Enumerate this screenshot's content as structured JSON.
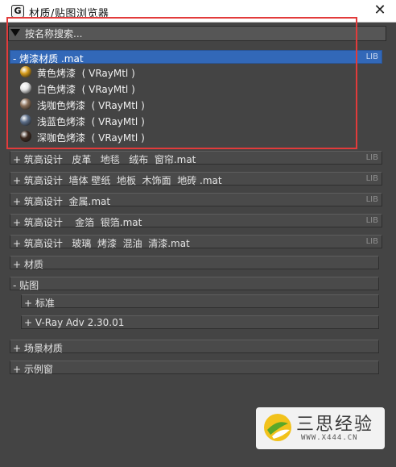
{
  "window": {
    "app_icon_glyph": "G",
    "title": "材质/贴图浏览器",
    "close_glyph": "✕"
  },
  "search": {
    "placeholder": "按名称搜索..."
  },
  "categories": {
    "lacquer": {
      "label": "- 烤漆材质 .mat",
      "lib": "LIB"
    },
    "leather": {
      "label": "+ 筑高设计   皮革   地毯   绒布  窗帘.mat",
      "lib": "LIB"
    },
    "wall": {
      "label": "+ 筑高设计  墙体 壁纸  地板  木饰面  地砖 .mat",
      "lib": "LIB"
    },
    "metal": {
      "label": "+ 筑高设计  金属.mat",
      "lib": "LIB"
    },
    "foil": {
      "label": "+ 筑高设计    金箔  银箔.mat",
      "lib": "LIB"
    },
    "glass": {
      "label": "+ 筑高设计   玻璃  烤漆  混油  清漆.mat",
      "lib": "LIB"
    },
    "materials": {
      "label": "+ 材质"
    },
    "maps": {
      "label": "- 贴图"
    },
    "scene": {
      "label": "+ 场景材质"
    },
    "sample": {
      "label": "+ 示例窗"
    }
  },
  "materials": [
    {
      "label": "黄色烤漆  ( VRayMtl )",
      "color": "#d49a1a"
    },
    {
      "label": "白色烤漆  ( VRayMtl )",
      "color": "#e8e8e8"
    },
    {
      "label": "浅咖色烤漆  ( VRayMtl )",
      "color": "#8a6f58"
    },
    {
      "label": "浅蓝色烤漆  ( VRayMtl )",
      "color": "#5d6f8a"
    },
    {
      "label": "深咖色烤漆  ( VRayMtl )",
      "color": "#3d2a20"
    }
  ],
  "maps_sub": {
    "standard": {
      "label": "+ 标准"
    },
    "vray": {
      "label": "+ V-Ray Adv 2.30.01"
    }
  },
  "watermark": {
    "text": "三思经验",
    "url": "WWW.X444.CN"
  },
  "colors": {
    "selected_header": "#3268b8",
    "highlight_border": "#e23b3b",
    "panel_bg": "#444444"
  }
}
